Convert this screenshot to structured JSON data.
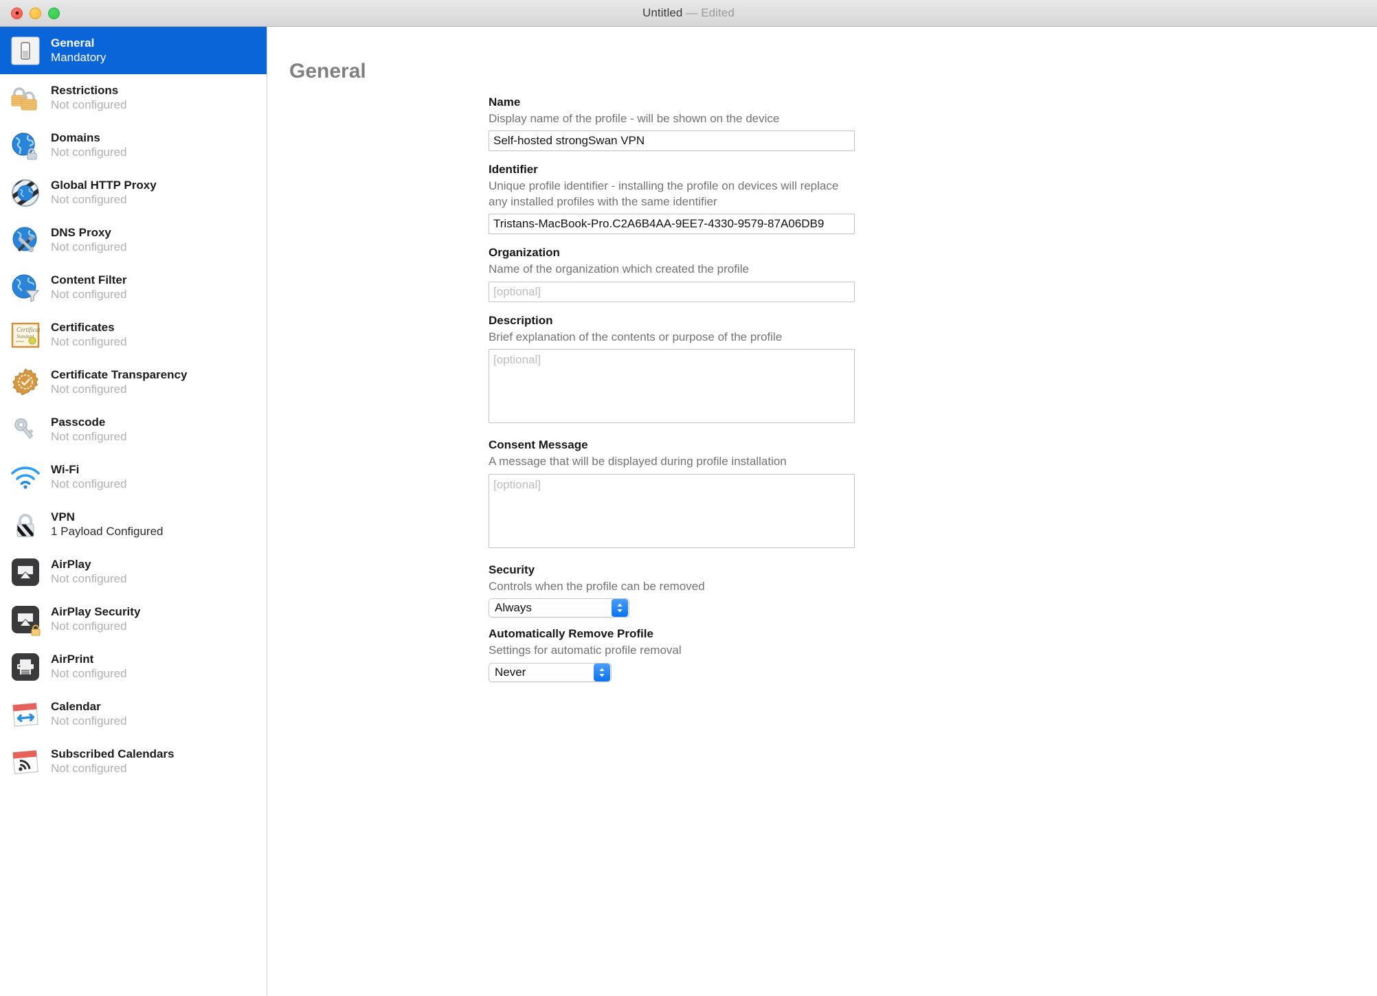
{
  "window": {
    "title": "Untitled",
    "title_separator": " — ",
    "title_state": "Edited"
  },
  "sidebar": {
    "items": [
      {
        "label": "General",
        "status": "Mandatory",
        "icon": "toggle-switch-icon",
        "selected": true
      },
      {
        "label": "Restrictions",
        "status": "Not configured",
        "icon": "padlocks-icon",
        "selected": false
      },
      {
        "label": "Domains",
        "status": "Not configured",
        "icon": "globe-lock-icon",
        "selected": false
      },
      {
        "label": "Global HTTP Proxy",
        "status": "Not configured",
        "icon": "globe-proxy-icon",
        "selected": false
      },
      {
        "label": "DNS Proxy",
        "status": "Not configured",
        "icon": "globe-tools-icon",
        "selected": false
      },
      {
        "label": "Content Filter",
        "status": "Not configured",
        "icon": "globe-funnel-icon",
        "selected": false
      },
      {
        "label": "Certificates",
        "status": "Not configured",
        "icon": "certificate-icon",
        "selected": false
      },
      {
        "label": "Certificate Transparency",
        "status": "Not configured",
        "icon": "certificate-badge-icon",
        "selected": false
      },
      {
        "label": "Passcode",
        "status": "Not configured",
        "icon": "key-icon",
        "selected": false
      },
      {
        "label": "Wi-Fi",
        "status": "Not configured",
        "icon": "wifi-icon",
        "selected": false
      },
      {
        "label": "VPN",
        "status": "1 Payload Configured",
        "icon": "vpn-lock-icon",
        "selected": false,
        "status_dark": true
      },
      {
        "label": "AirPlay",
        "status": "Not configured",
        "icon": "airplay-icon",
        "selected": false
      },
      {
        "label": "AirPlay Security",
        "status": "Not configured",
        "icon": "airplay-lock-icon",
        "selected": false
      },
      {
        "label": "AirPrint",
        "status": "Not configured",
        "icon": "airprint-icon",
        "selected": false
      },
      {
        "label": "Calendar",
        "status": "Not configured",
        "icon": "calendar-icon",
        "selected": false
      },
      {
        "label": "Subscribed Calendars",
        "status": "Not configured",
        "icon": "calendar-rss-icon",
        "selected": false
      }
    ]
  },
  "main": {
    "heading": "General",
    "fields": {
      "name": {
        "label": "Name",
        "help": "Display name of the profile - will be shown on the device",
        "value": "Self-hosted strongSwan VPN"
      },
      "identifier": {
        "label": "Identifier",
        "help": "Unique profile identifier - installing the profile on devices will replace any installed profiles with the same identifier",
        "value": "Tristans-MacBook-Pro.C2A6B4AA-9EE7-4330-9579-87A06DB9"
      },
      "organization": {
        "label": "Organization",
        "help": "Name of the organization which created the profile",
        "placeholder": "[optional]",
        "value": ""
      },
      "description": {
        "label": "Description",
        "help": "Brief explanation of the contents or purpose of the profile",
        "placeholder": "[optional]",
        "value": ""
      },
      "consent_message": {
        "label": "Consent Message",
        "help": "A message that will be displayed during profile installation",
        "placeholder": "[optional]",
        "value": ""
      },
      "security": {
        "label": "Security",
        "help": "Controls when the profile can be removed",
        "selected": "Always"
      },
      "auto_remove": {
        "label": "Automatically Remove Profile",
        "help": "Settings for automatic profile removal",
        "selected": "Never"
      }
    }
  },
  "colors": {
    "selection_blue": "#0a66d8",
    "popup_arrow_blue": "#0a73f0",
    "heading_gray": "#808080",
    "help_gray": "#737373",
    "status_gray": "#b0b0b0"
  }
}
